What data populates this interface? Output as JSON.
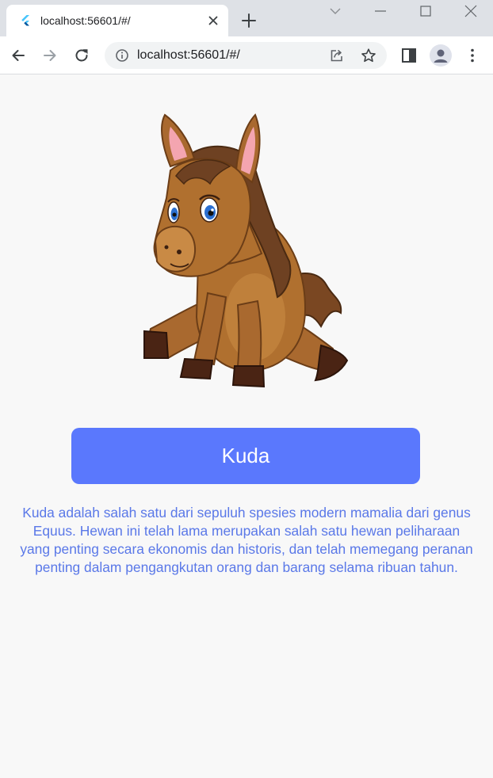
{
  "browser": {
    "tab_title": "localhost:56601/#/",
    "url": "localhost:56601/#/"
  },
  "icons": {
    "favicon": "flutter-icon",
    "tab_close": "close-icon",
    "new_tab": "plus-icon",
    "minimize": "minimize-icon",
    "maximize": "maximize-icon",
    "close_window": "close-icon",
    "back": "arrow-left-icon",
    "forward": "arrow-right-icon",
    "reload": "reload-icon",
    "site_info": "info-icon",
    "share": "share-icon",
    "bookmark": "star-icon",
    "side_panel": "side-panel-icon",
    "profile": "person-icon",
    "menu": "kebab-menu-icon"
  },
  "colors": {
    "accent": "#5a78fd",
    "text": "#5a78e8",
    "background": "#f8f8f8"
  },
  "main": {
    "image": "horse-illustration",
    "button_label": "Kuda",
    "description": "Kuda adalah salah satu dari sepuluh spesies modern mamalia dari genus Equus. Hewan ini telah lama merupakan salah satu hewan peliharaan yang penting secara ekonomis dan historis, dan telah memegang peranan penting dalam pengangkutan orang dan barang selama ribuan tahun."
  }
}
